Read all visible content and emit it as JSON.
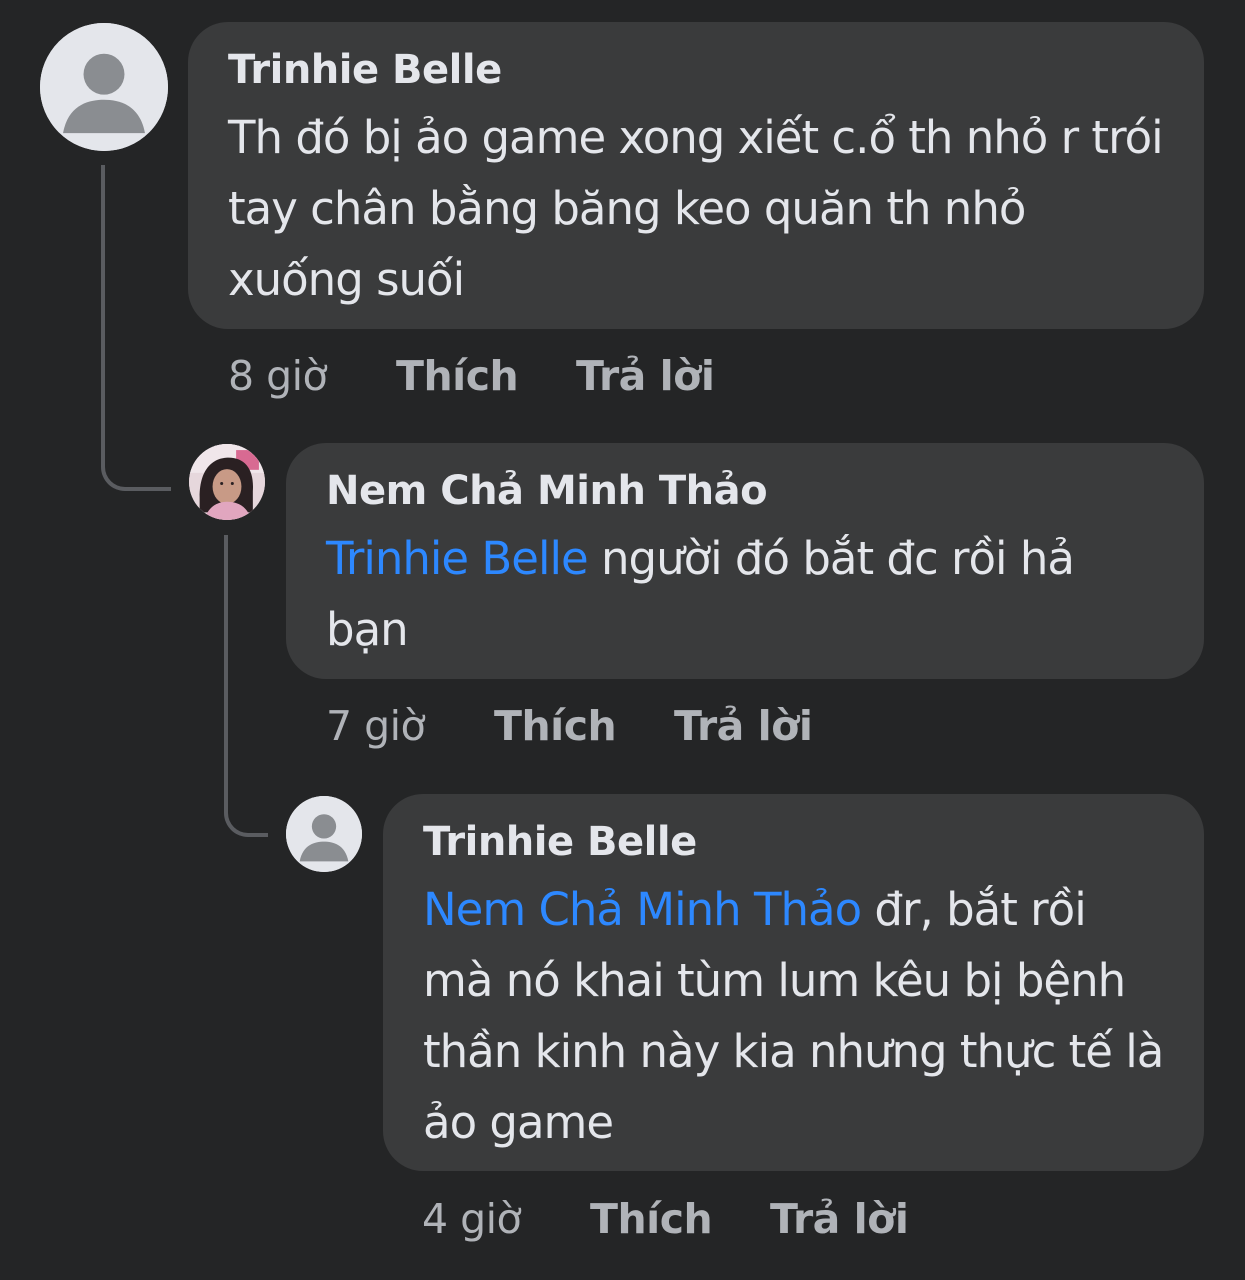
{
  "comments": [
    {
      "author": "Trinhie Belle",
      "mention": "",
      "text": "Th đó bị ảo game xong xiết c.ổ th nhỏ r trói tay chân bằng băng keo quăn th nhỏ xuống suối",
      "time": "8 giờ",
      "like_label": "Thích",
      "reply_label": "Trả lời",
      "avatar_icon": "default-avatar-icon"
    },
    {
      "author": "Nem Chả Minh Thảo",
      "mention": "Trinhie Belle",
      "text": "người đó bắt đc rồi hả bạn",
      "time": "7 giờ",
      "like_label": "Thích",
      "reply_label": "Trả lời",
      "avatar_icon": "profile-photo"
    },
    {
      "author": "Trinhie Belle",
      "mention": "Nem Chả Minh Thảo",
      "text": "đr, bắt rồi mà nó khai tùm lum kêu bị bệnh thần kinh này kia nhưng thực tế là ảo game",
      "time": "4 giờ",
      "like_label": "Thích",
      "reply_label": "Trả lời",
      "avatar_icon": "default-avatar-icon"
    }
  ],
  "colors": {
    "background": "#242526",
    "bubble": "#3a3b3c",
    "text": "#e4e6eb",
    "secondary_text": "#b0b3b8",
    "mention": "#2d88ff"
  }
}
